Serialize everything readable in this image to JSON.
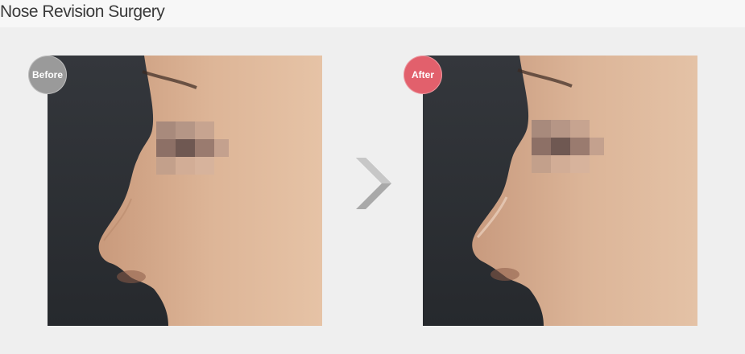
{
  "header": {
    "title": "Nose Revision Surgery"
  },
  "before": {
    "badge_label": "Before",
    "badge_color": "#9a9a9a"
  },
  "after": {
    "badge_label": "After",
    "badge_color": "#e2606c"
  },
  "arrow": {
    "icon": "chevron-right-icon",
    "color": "#a9a9a9"
  }
}
